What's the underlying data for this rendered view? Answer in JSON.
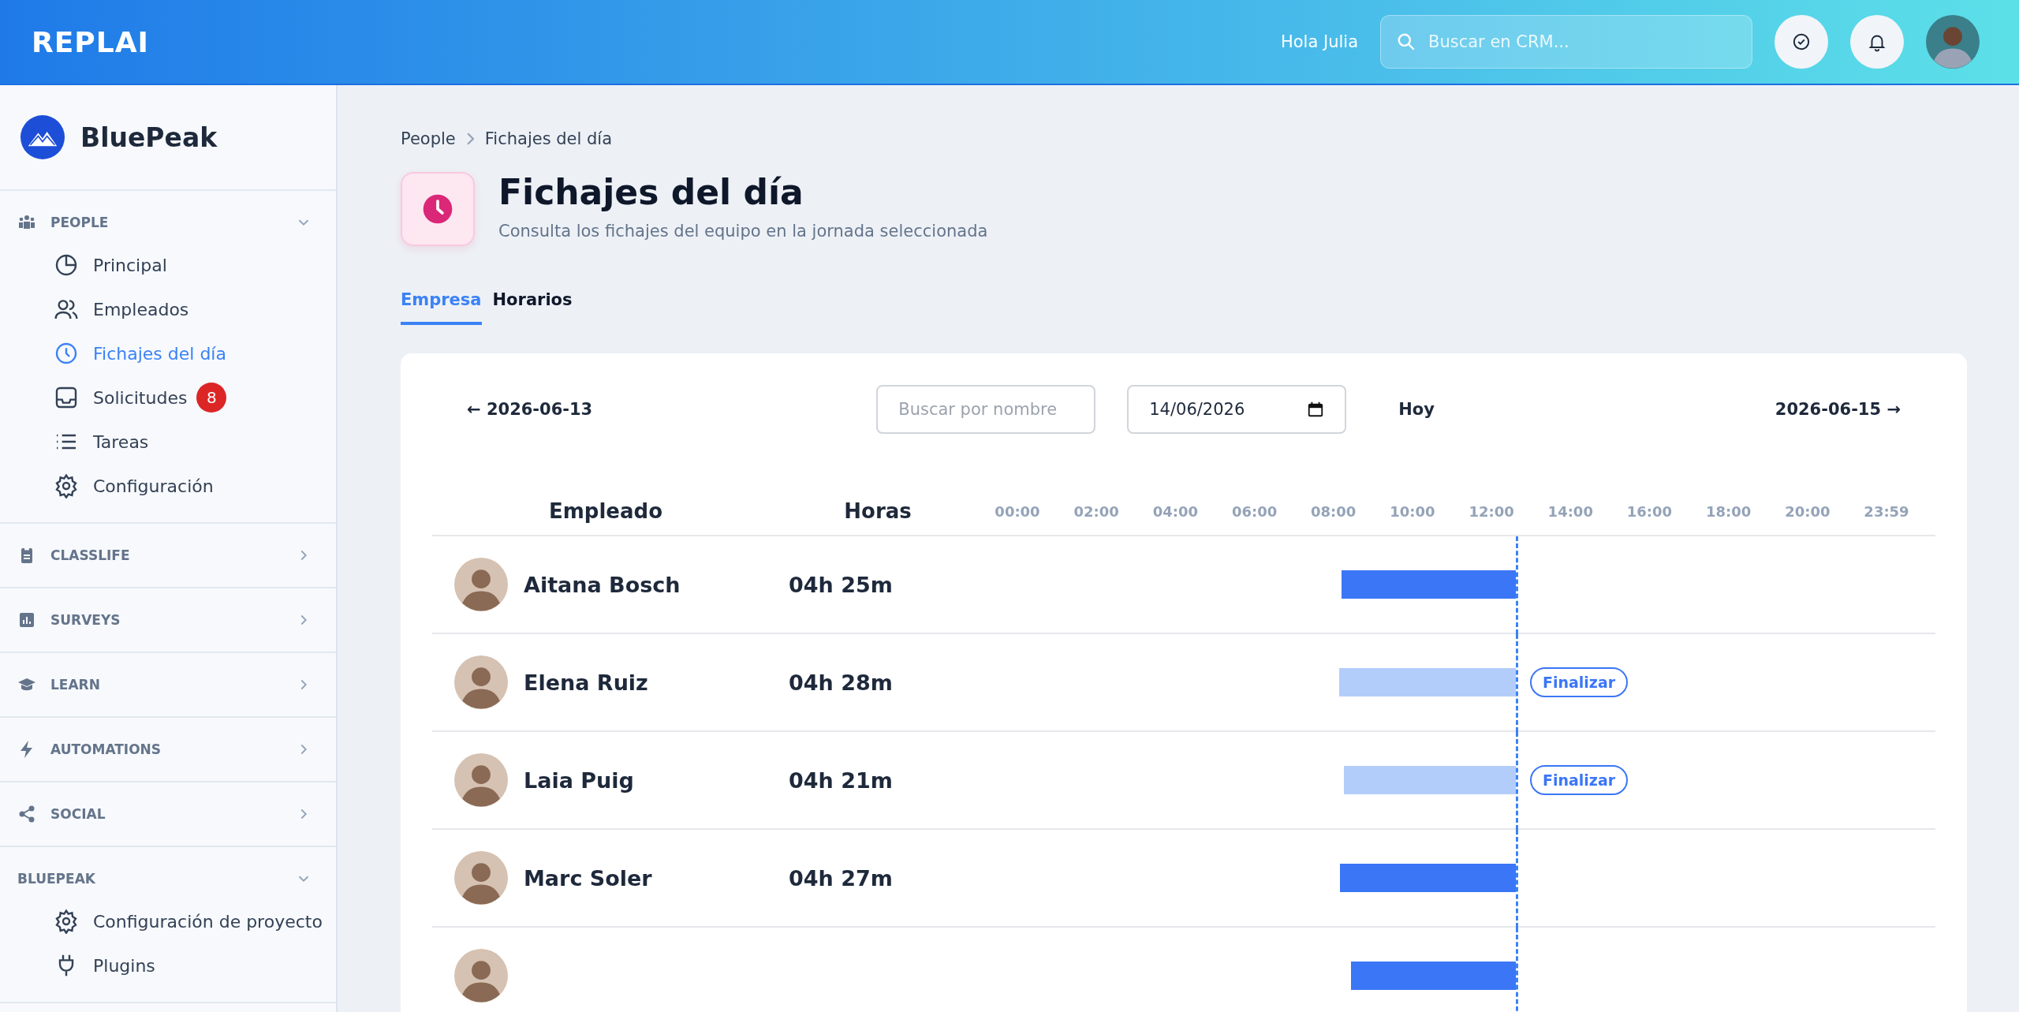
{
  "topbar": {
    "logo": "REPLAI",
    "greeting": "Hola Julia",
    "search": {
      "placeholder": "Buscar en CRM..."
    }
  },
  "sidebar": {
    "brand": "BluePeak",
    "sections": [
      {
        "label": "PEOPLE",
        "expanded": true,
        "items": [
          {
            "label": "Principal",
            "selected": false
          },
          {
            "label": "Empleados",
            "selected": false
          },
          {
            "label": "Fichajes del día",
            "selected": true
          },
          {
            "label": "Solicitudes",
            "selected": false,
            "badge": "8"
          },
          {
            "label": "Tareas",
            "selected": false
          },
          {
            "label": "Configuración",
            "selected": false
          }
        ]
      },
      {
        "label": "CLASSLIFE",
        "expanded": false
      },
      {
        "label": "SURVEYS",
        "expanded": false
      },
      {
        "label": "LEARN",
        "expanded": false
      },
      {
        "label": "AUTOMATIONS",
        "expanded": false
      },
      {
        "label": "SOCIAL",
        "expanded": false
      },
      {
        "label": "BLUEPEAK",
        "expanded": true,
        "items": [
          {
            "label": "Configuración de proyecto",
            "selected": false
          },
          {
            "label": "Plugins",
            "selected": false
          }
        ]
      }
    ]
  },
  "breadcrumb": [
    "People",
    "Fichajes del día"
  ],
  "page": {
    "title": "Fichajes del día",
    "subtitle": "Consulta los fichajes del equipo en la jornada seleccionada"
  },
  "tabs": [
    {
      "label": "Empresa",
      "selected": true
    },
    {
      "label": "Horarios",
      "selected": false
    }
  ],
  "toolbar": {
    "previous": "← 2026-06-13",
    "name_search": {
      "placeholder": "Buscar por nombre"
    },
    "date": "14/06/2026",
    "today": "Hoy",
    "next": "2026-06-15 →"
  },
  "table": {
    "columns": [
      "Empleado",
      "Horas"
    ],
    "ticks": [
      "00:00",
      "02:00",
      "04:00",
      "06:00",
      "08:00",
      "10:00",
      "12:00",
      "14:00",
      "16:00",
      "18:00",
      "20:00",
      "23:59"
    ],
    "rows": [
      {
        "name": "Aitana Bosch",
        "hours": "04h 25m",
        "open": false
      },
      {
        "name": "Elena Ruiz",
        "hours": "04h 28m",
        "open": true,
        "action": "Finalizar"
      },
      {
        "name": "Laia Puig",
        "hours": "04h 21m",
        "open": true,
        "action": "Finalizar"
      },
      {
        "name": "Marc Soler",
        "hours": "04h 27m",
        "open": false
      },
      {
        "open": false
      }
    ]
  }
}
